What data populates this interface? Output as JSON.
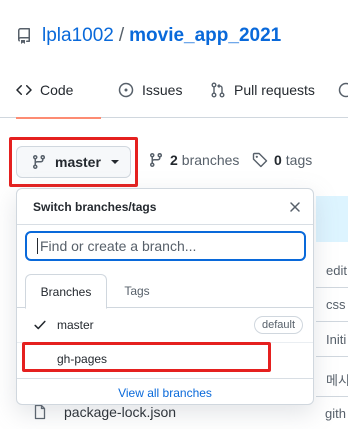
{
  "repo": {
    "owner": "lpla1002",
    "separator": "/",
    "name": "movie_app_2021"
  },
  "tabs": [
    {
      "label": "Code",
      "icon": "code-icon",
      "selected": true
    },
    {
      "label": "Issues",
      "icon": "issue-icon",
      "selected": false
    },
    {
      "label": "Pull requests",
      "icon": "pull-request-icon",
      "selected": false
    }
  ],
  "branch_selector": {
    "current": "master",
    "branches_count": "2",
    "branches_label": "branches",
    "tags_count": "0",
    "tags_label": "tags"
  },
  "dropdown": {
    "title": "Switch branches/tags",
    "filter_placeholder": "Find or create a branch...",
    "tabs": [
      "Branches",
      "Tags"
    ],
    "branches": [
      {
        "name": "master",
        "badge": "default",
        "checked": true
      },
      {
        "name": "gh-pages",
        "checked": false
      }
    ],
    "footer_link": "View all branches"
  },
  "background": {
    "commit_snippets": [
      "edit",
      "css",
      "Initi",
      "메시",
      "gith"
    ],
    "file_name": "package-lock.json"
  },
  "colors": {
    "link": "#0969da",
    "tab_underline": "#fd8c73",
    "highlight": "#e5201f",
    "row_highlight": "#ddf4ff"
  }
}
